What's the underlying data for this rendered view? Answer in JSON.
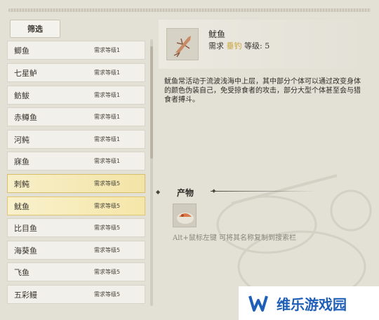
{
  "filter": {
    "label": "筛选"
  },
  "fish_list": [
    {
      "name": "鲫鱼",
      "req": "需求等级1",
      "state": "normal"
    },
    {
      "name": "七星鲈",
      "req": "需求等级1",
      "state": "normal"
    },
    {
      "name": "鲂鮁",
      "req": "需求等级1",
      "state": "normal"
    },
    {
      "name": "赤鳟鱼",
      "req": "需求等级1",
      "state": "normal"
    },
    {
      "name": "河鲀",
      "req": "需求等级1",
      "state": "normal"
    },
    {
      "name": "寐鱼",
      "req": "需求等级1",
      "state": "normal"
    },
    {
      "name": "刺鲀",
      "req": "需求等级5",
      "state": "highlight"
    },
    {
      "name": "鱿鱼",
      "req": "需求等级5",
      "state": "selected"
    },
    {
      "name": "比目鱼",
      "req": "需求等级5",
      "state": "normal"
    },
    {
      "name": "海葵鱼",
      "req": "需求等级5",
      "state": "normal"
    },
    {
      "name": "飞鱼",
      "req": "需求等级5",
      "state": "normal"
    },
    {
      "name": "五彩鳗",
      "req": "需求等级5",
      "state": "normal"
    }
  ],
  "detail": {
    "name": "鱿鱼",
    "req_prefix": "需求",
    "req_skill": "垂钓",
    "req_suffix": "等级:",
    "req_level": "5",
    "description": "鱿鱼常活动于流波浅海中上层，其中部分个体可以通过改变身体的颜色伪装自己，免受掠食者的攻击，部分大型个体甚至会与猎食者搏斗。"
  },
  "product": {
    "label": "产物",
    "hint": "Alt+鼠标左键 可将其名称复制到搜索栏"
  },
  "watermark": {
    "text": "维乐游戏园"
  },
  "colors": {
    "accent_gold": "#c9a43a",
    "watermark_blue": "#1f5fb8"
  }
}
